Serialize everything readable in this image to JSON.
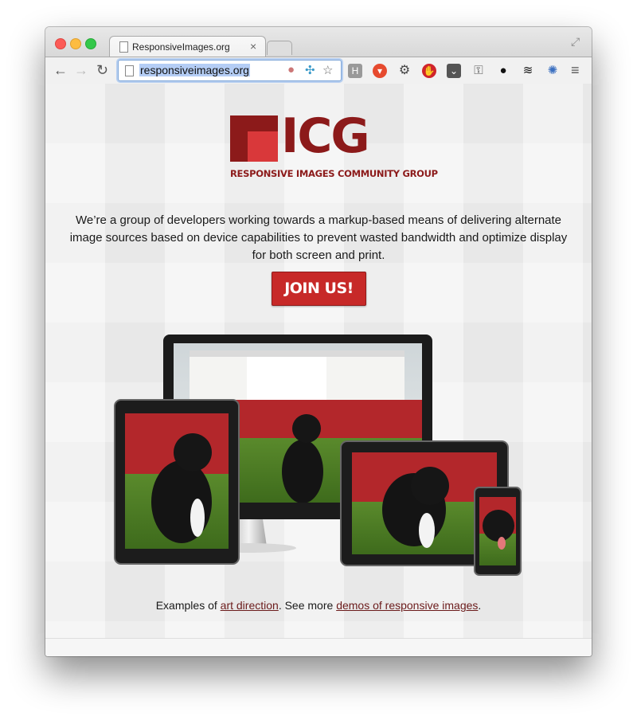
{
  "browser": {
    "tab_title": "ResponsiveImages.org",
    "tab_close": "×",
    "url": "responsiveimages.org",
    "back": "←",
    "forward": "→",
    "reload": "↻",
    "menu": "≡"
  },
  "page": {
    "logo_letters": "ICG",
    "logo_tagline": "RESPONSIVE IMAGES COMMUNITY GROUP",
    "intro": "We’re a group of developers working towards a markup-based means of delivering alternate image sources based on device capabilities to prevent wasted bandwidth and optimize display for both screen and print.",
    "join_label": "JOIN US!",
    "examples_prefix": "Examples of ",
    "art_direction_link": "art direction",
    "examples_middle": ". See more ",
    "demos_link": "demos of responsive images",
    "examples_suffix": "."
  },
  "colors": {
    "brand": "#8c1a1a",
    "button": "#c72928"
  }
}
